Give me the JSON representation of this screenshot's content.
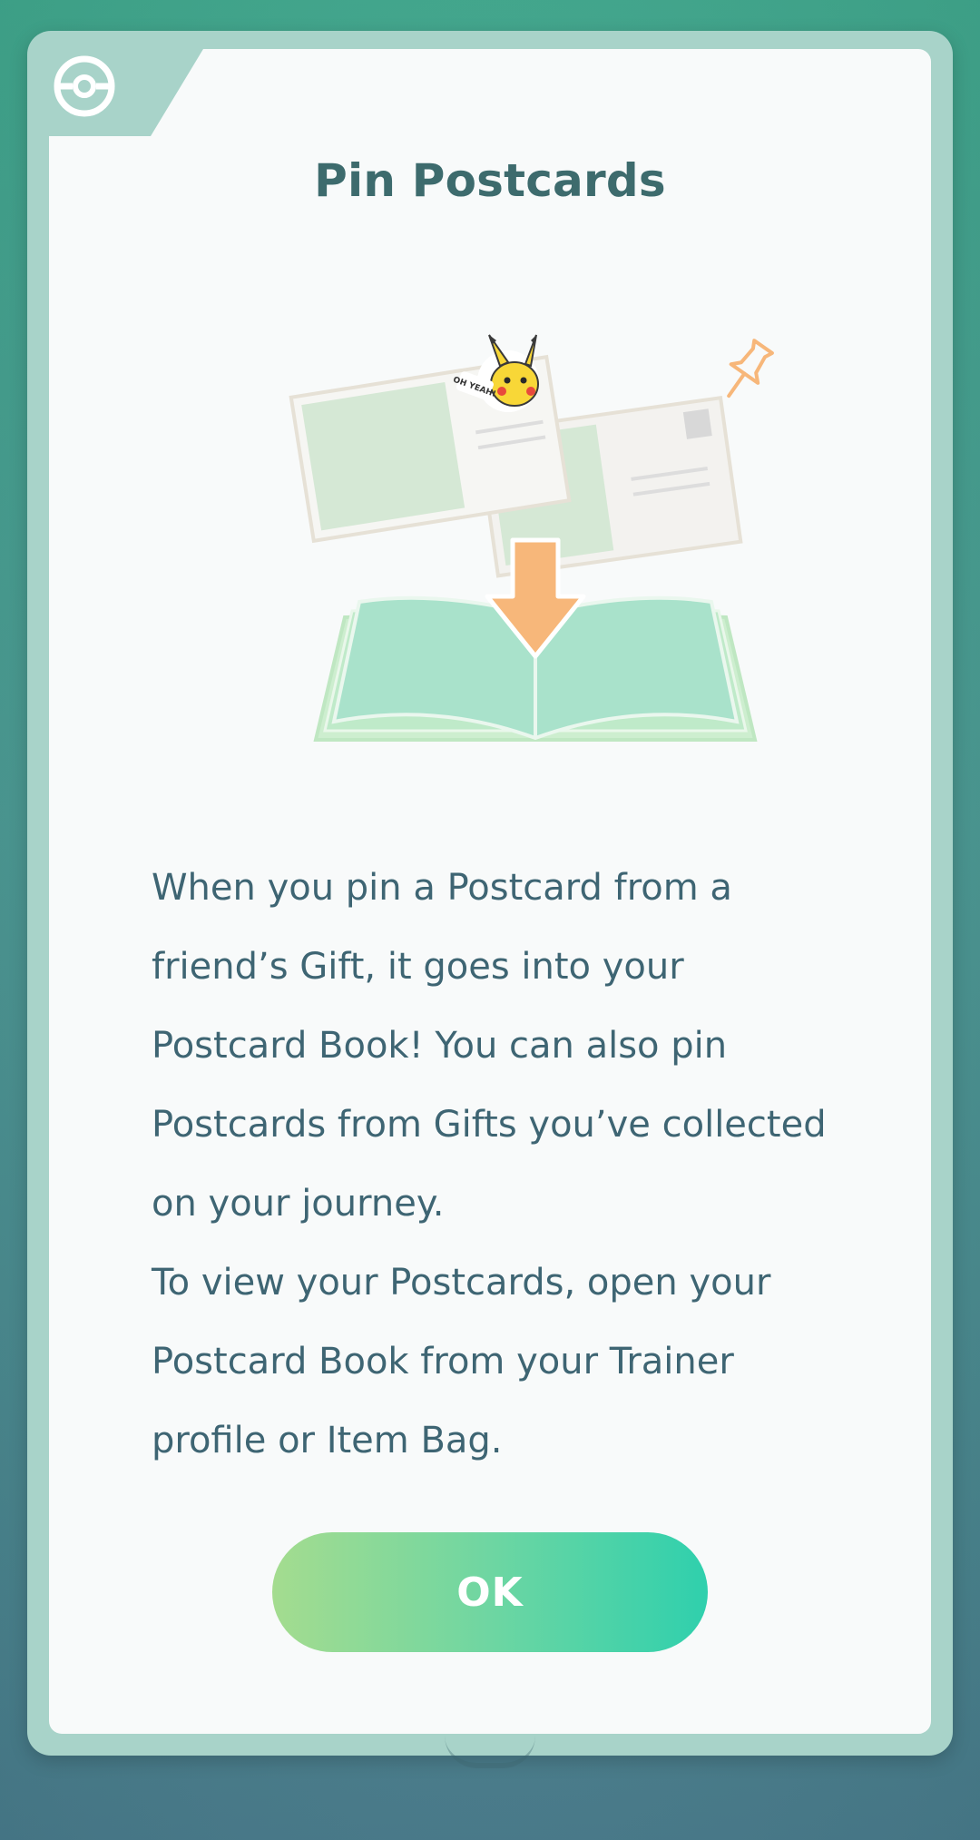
{
  "dialog": {
    "title": "Pin Postcards",
    "paragraph_1": "When you pin a Postcard from a friend’s Gift, it goes into your Postcard Book! You can also pin Postcards from Gifts you’ve collected on your journey.",
    "paragraph_2": "To view your Postcards, open your Postcard Book from your Trainer profile or Item Bag.",
    "ok_label": "OK",
    "sticker_text": "OH YEAH!"
  },
  "icons": {
    "corner": "pokeball-icon",
    "pin": "pushpin-icon",
    "arrow": "down-arrow-icon",
    "book": "open-book-icon",
    "postcards": "postcard-icon"
  },
  "colors": {
    "title": "#3d6b6d",
    "text": "#3e6573",
    "button_start": "#a4dc8f",
    "button_end": "#2fd0ad",
    "card": "#f8fafa",
    "frame": "#a8d3c9",
    "accent_orange": "#f7b77a"
  }
}
